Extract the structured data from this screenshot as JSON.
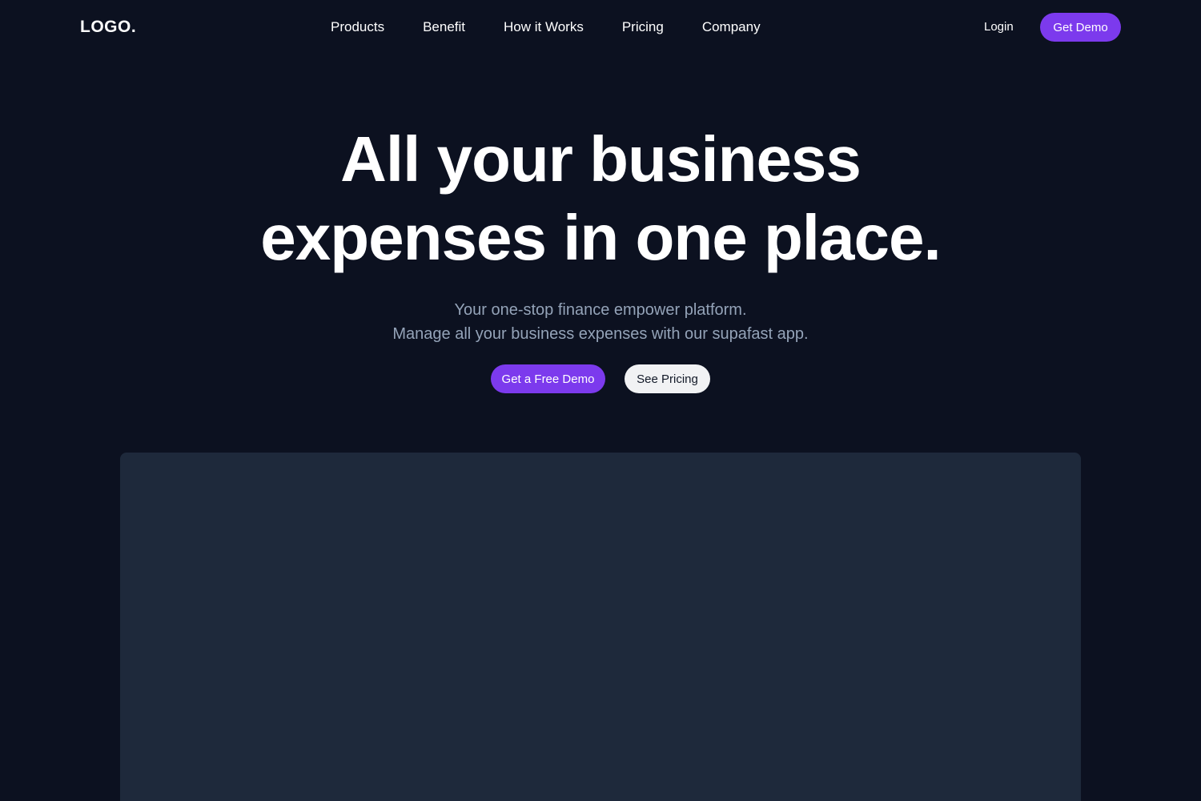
{
  "header": {
    "logo": "LOGO.",
    "nav": [
      "Products",
      "Benefit",
      "How it Works",
      "Pricing",
      "Company"
    ],
    "login_label": "Login",
    "demo_label": "Get Demo"
  },
  "hero": {
    "title_line1": "All your business",
    "title_line2": "expenses in one place.",
    "subtitle_line1": "Your one-stop finance empower platform.",
    "subtitle_line2": "Manage all your business expenses with our supafast app.",
    "primary_cta": "Get a Free Demo",
    "secondary_cta": "See Pricing"
  },
  "colors": {
    "background": "#0c1120",
    "accent": "#7c3aed",
    "panel": "#1e293b",
    "subtitle": "#94a3b8"
  }
}
